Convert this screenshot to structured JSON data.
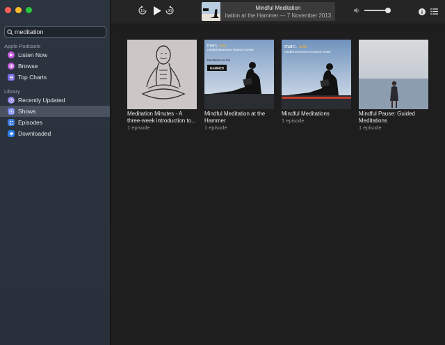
{
  "sidebar": {
    "search": {
      "value": "meditation",
      "placeholder": "Search"
    },
    "sections": {
      "apple_podcasts": "Apple Podcasts",
      "library": "Library"
    },
    "apple_items": [
      {
        "label": "Listen Now",
        "icon": "play-circle-icon",
        "color": "#c45ae0"
      },
      {
        "label": "Browse",
        "icon": "podcast-icon",
        "color": "#c45ae0"
      },
      {
        "label": "Top Charts",
        "icon": "list-icon",
        "color": "#7a6be0"
      }
    ],
    "library_items": [
      {
        "label": "Recently Updated",
        "icon": "clock-icon",
        "color": "#8a7be8"
      },
      {
        "label": "Shows",
        "icon": "shows-icon",
        "color": "#6a7bea",
        "selected": true
      },
      {
        "label": "Episodes",
        "icon": "episodes-icon",
        "color": "#3a7bdc"
      },
      {
        "label": "Downloaded",
        "icon": "download-cloud-icon",
        "color": "#2a7ee8"
      }
    ]
  },
  "toolbar": {
    "skip_back": "15",
    "skip_forward": "30",
    "now_playing": {
      "title": "Mindful Meditation",
      "subtitle": "itation at the Hammer — 7 November 2013"
    },
    "volume": 0.9
  },
  "shows": [
    {
      "title": "Meditation Minutes - A three-week introduction to...",
      "episodes": "1 episode",
      "art": "drawing"
    },
    {
      "title": "Mindful Meditation at the Hammer",
      "episodes": "1 episode",
      "art": "hammer",
      "art_text": {
        "brand": "marc.",
        "brand2": "ucla",
        "line": "mindful awareness research center",
        "sub": "Meditation at the",
        "badge": "HAMMER"
      }
    },
    {
      "title": "Mindful Meditations",
      "episodes": "1 episode",
      "art": "marc",
      "art_text": {
        "brand": "marc.",
        "brand2": "ucla",
        "line": "mindful awareness research center"
      }
    },
    {
      "title": "Mindful Pause: Guided Meditations",
      "episodes": "1 episode",
      "art": "pause"
    }
  ]
}
